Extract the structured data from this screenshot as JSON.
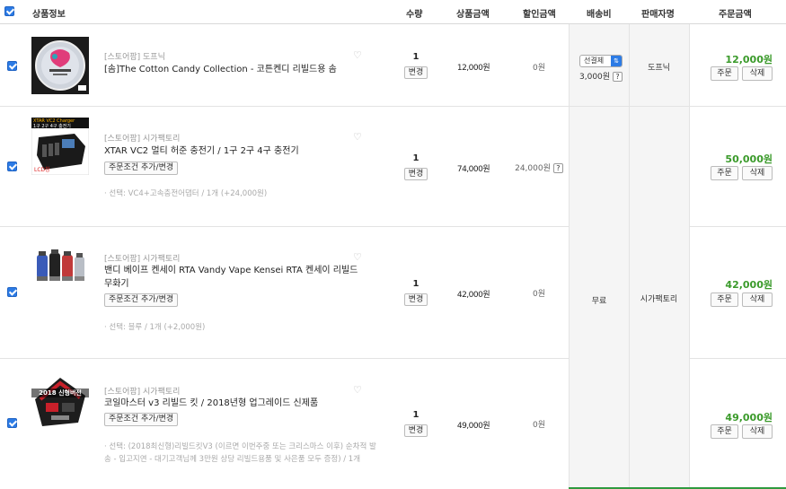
{
  "header": {
    "product_info": "상품정보",
    "qty": "수량",
    "price": "상품금액",
    "discount": "할인금액",
    "shipping": "배송비",
    "seller": "판매자명",
    "order_total": "주문금액"
  },
  "shipping": {
    "select_label": "선결제",
    "fee": "3,000원",
    "free": "무료"
  },
  "sellers": {
    "dopnik": "도프닉",
    "cigar": "시가팩토리"
  },
  "labels": {
    "change": "변경",
    "order": "주문",
    "delete": "삭제",
    "add_option": "주문조건 추가/변경",
    "help": "?",
    "heart": "♡"
  },
  "items": [
    {
      "store": "[스토어팜] 도프닉",
      "name": "[솜]The Cotton Candy Collection - 코튼켄디 리빌드용 솜",
      "qty": "1",
      "price": "12,000원",
      "discount": "0원",
      "total": "12,000원",
      "thumb": "cotton-candy-package"
    },
    {
      "store": "[스토어팜] 시가팩토리",
      "name": "XTAR VC2 멀티 허준 충전기 / 1구 2구 4구 충전기",
      "option": "· 선택: VC4+고속충전어댑터 / 1개 (+24,000원)",
      "qty": "1",
      "price": "74,000원",
      "discount": "24,000원",
      "total": "50,000원",
      "thumb_text_top": "XTAR VC2 Charger",
      "thumb_text_sub": "1구 2구 4구 충전기",
      "thumb_text_lcd": "LCD창"
    },
    {
      "store": "[스토어팜] 시가팩토리",
      "name": "밴디 베이프 켄세이 RTA Vandy Vape Kensei RTA 켄세이 리빌드 무화기",
      "option": "· 선택: 블루 / 1개 (+2,000원)",
      "qty": "1",
      "price": "42,000원",
      "discount": "0원",
      "total": "42,000원",
      "thumb": "rta-atomizers"
    },
    {
      "store": "[스토어팜] 시가팩토리",
      "name": "코일마스터 v3 리빌드 킷 / 2018년형 업그레이드 신제품",
      "option": "· 선택: (2018최신형)리빌드킷V3 (이르면 이번주중 또는 크리스마스 이후) 순차적 발송 - 입고지연 - 대기고객님께 3만원 상당 리빌드용품 및 사은품 모두 증정) / 1개",
      "qty": "1",
      "price": "49,000원",
      "discount": "0원",
      "total": "49,000원",
      "thumb_text": "2018 신형버전"
    }
  ],
  "colors": {
    "accent": "#2c7be5",
    "total_green": "#3a9a2a"
  }
}
